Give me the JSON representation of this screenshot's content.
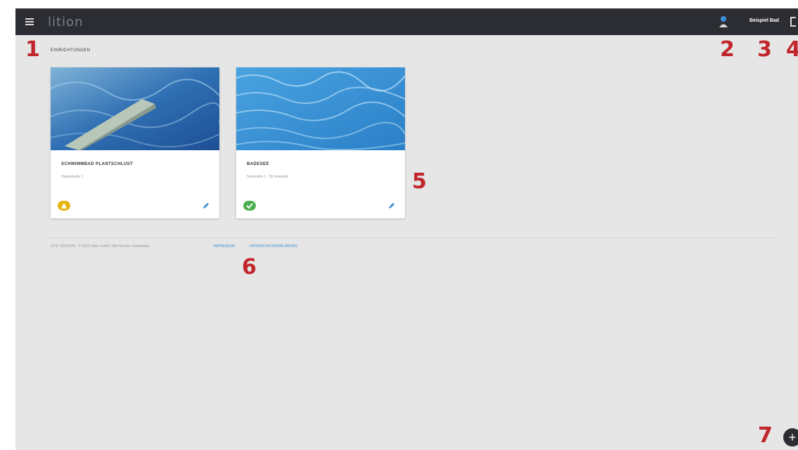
{
  "header": {
    "logo": "lition",
    "user_name": "Beispiel Bad"
  },
  "section": {
    "title": "EINRICHTUNGEN"
  },
  "cards": [
    {
      "title": "SCHWIMMBAD PLANTSCHLUST",
      "subtitle": "Hauptstraße 1",
      "status": "warning",
      "status_color": "#e8b30e"
    },
    {
      "title": "BADESEE",
      "subtitle": "Seestraße 1 · 99 Seestadt",
      "status": "ok",
      "status_color": "#4caf50"
    }
  ],
  "footer": {
    "text": "SITE VERSION · © 2023 Lition GmbH. Alle Rechte vorbehalten.",
    "links": [
      "IMPRESSUM",
      "DATENSCHUTZERKLÄRUNG"
    ]
  },
  "markers": [
    "1",
    "2",
    "3",
    "4",
    "5",
    "6",
    "7"
  ],
  "colors": {
    "topbar": "#2c2d33",
    "accent": "#3b8fd6",
    "marker": "#c0262c"
  },
  "icons": {
    "menu": "hamburger-icon",
    "user": "user-icon",
    "logout": "logout-icon",
    "edit": "pencil-icon",
    "add": "plus-icon"
  }
}
